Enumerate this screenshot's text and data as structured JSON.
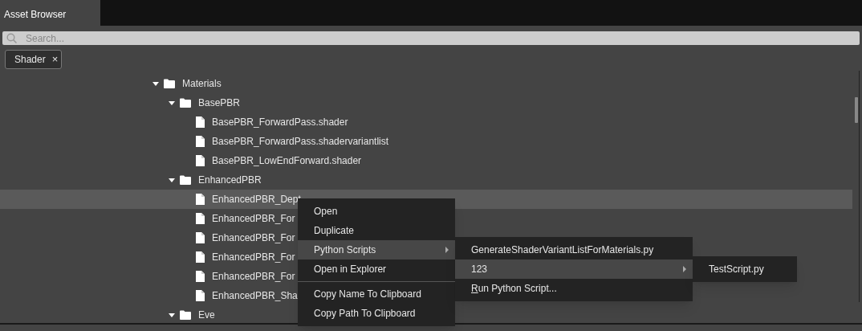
{
  "tabs": [
    {
      "label": "Asset Browser",
      "selected": true
    }
  ],
  "search": {
    "placeholder": "Search..."
  },
  "filters": [
    {
      "label": "Shader",
      "close": "×"
    }
  ],
  "tree": [
    {
      "label": "Materials",
      "kind": "folder",
      "expanded": true,
      "selected": false,
      "children": [
        {
          "label": "BasePBR",
          "kind": "folder",
          "expanded": true,
          "selected": false,
          "children": [
            {
              "label": "BasePBR_ForwardPass.shader",
              "kind": "file",
              "selected": false
            },
            {
              "label": "BasePBR_ForwardPass.shadervariantlist",
              "kind": "file",
              "selected": false
            },
            {
              "label": "BasePBR_LowEndForward.shader",
              "kind": "file",
              "selected": false
            }
          ]
        },
        {
          "label": "EnhancedPBR",
          "kind": "folder",
          "expanded": true,
          "selected": false,
          "children": [
            {
              "label": "EnhancedPBR_Dept",
              "kind": "file",
              "selected": true
            },
            {
              "label": "EnhancedPBR_For",
              "kind": "file",
              "selected": false
            },
            {
              "label": "EnhancedPBR_For",
              "kind": "file",
              "selected": false
            },
            {
              "label": "EnhancedPBR_For",
              "kind": "file",
              "selected": false
            },
            {
              "label": "EnhancedPBR_For",
              "kind": "file",
              "selected": false
            },
            {
              "label": "EnhancedPBR_Sha",
              "kind": "file",
              "selected": false
            }
          ]
        },
        {
          "label": "Eve",
          "kind": "folder",
          "expanded": true,
          "selected": false
        }
      ]
    }
  ],
  "context_menu": {
    "items": [
      {
        "label": "Open",
        "kind": "item",
        "selected": false
      },
      {
        "label": "Duplicate",
        "kind": "item",
        "selected": false
      },
      {
        "label": "Python Scripts",
        "kind": "submenu",
        "selected": true
      },
      {
        "label": "Open in Explorer",
        "kind": "item",
        "selected": false
      },
      {
        "label": "Copy Name To Clipboard",
        "kind": "item",
        "selected": false,
        "separator_before": true
      },
      {
        "label": "Copy Path To Clipboard",
        "kind": "item",
        "selected": false
      }
    ]
  },
  "submenu": {
    "items": [
      {
        "label": "GenerateShaderVariantListForMaterials.py",
        "kind": "item",
        "selected": false
      },
      {
        "label": "123",
        "kind": "submenu",
        "selected": true
      },
      {
        "label": "Run Python Script...",
        "kind": "item",
        "selected": false,
        "first_letter_underlined": true
      }
    ]
  },
  "submenu_2": {
    "items": [
      {
        "label": "TestScript.py",
        "kind": "item",
        "selected": false
      }
    ]
  }
}
